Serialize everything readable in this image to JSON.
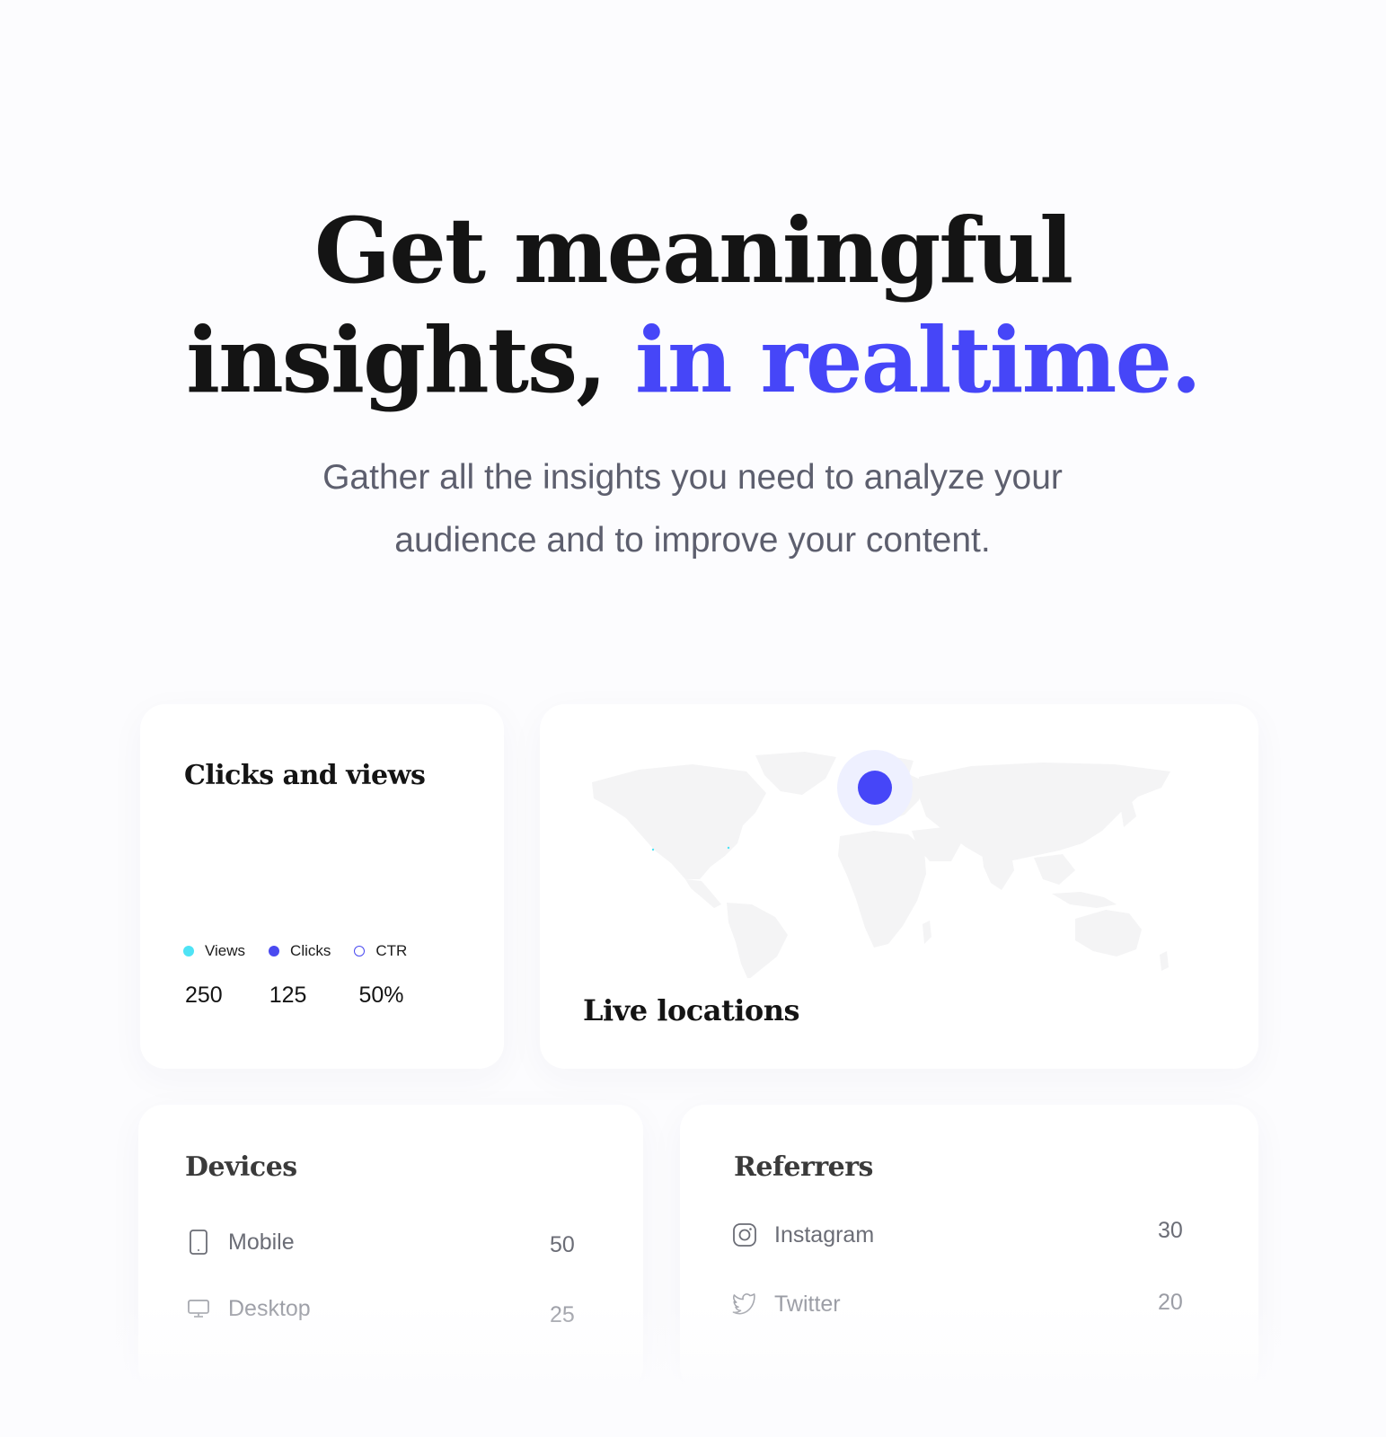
{
  "hero": {
    "title_line1": "Get meaningful",
    "title_line2": "insights,",
    "title_accent": "in realtime.",
    "subtitle_line1": "Gather all the insights you need to analyze your",
    "subtitle_line2": "audience and to improve your content."
  },
  "colors": {
    "accent": "#4646f8",
    "views": "#4ee3f5",
    "clicks": "#4a4af0"
  },
  "clicks_views": {
    "title": "Clicks and views",
    "legend": [
      {
        "label": "Views"
      },
      {
        "label": "Clicks"
      },
      {
        "label": "CTR"
      }
    ],
    "stats": [
      "250",
      "125",
      "50%"
    ]
  },
  "map": {
    "title": "Live locations"
  },
  "devices": {
    "title": "Devices",
    "items": [
      {
        "icon": "mobile-icon",
        "label": "Mobile",
        "value": "50"
      },
      {
        "icon": "desktop-icon",
        "label": "Desktop",
        "value": "25"
      }
    ]
  },
  "referrers": {
    "title": "Referrers",
    "items": [
      {
        "icon": "instagram-icon",
        "label": "Instagram",
        "value": "30"
      },
      {
        "icon": "twitter-icon",
        "label": "Twitter",
        "value": "20"
      }
    ]
  }
}
